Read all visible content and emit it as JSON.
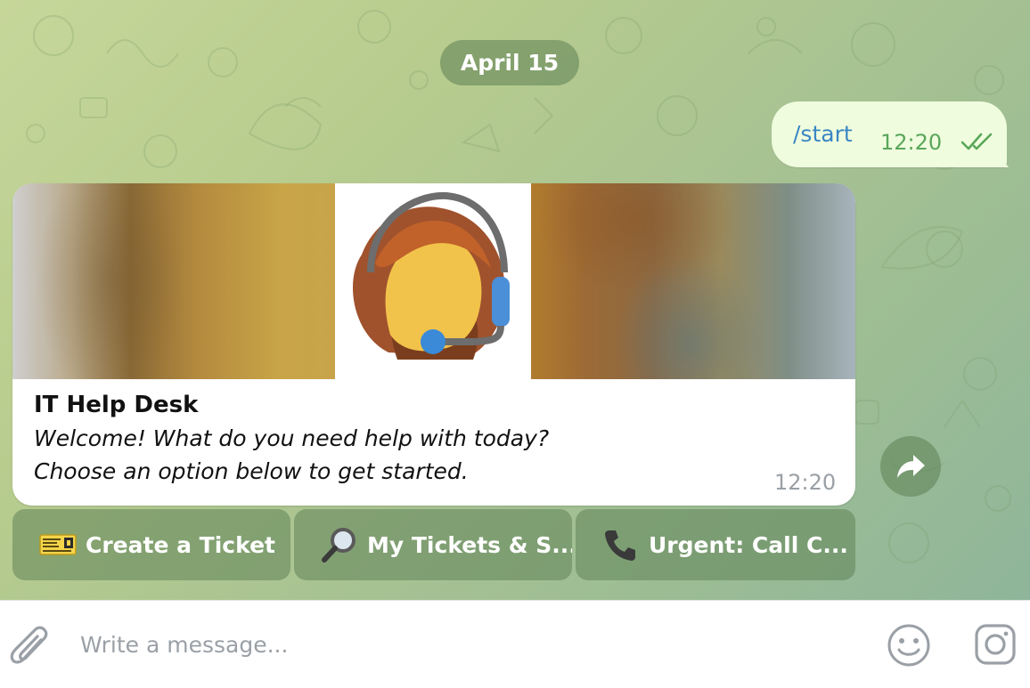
{
  "chat": {
    "date_label": "April 15",
    "outgoing": {
      "text": "/start",
      "time": "12:20",
      "status_icon": "double-check-icon"
    },
    "incoming": {
      "title": "IT Help Desk",
      "line1": "Welcome! What do you need help with today?",
      "line2": "Choose an option below to get started.",
      "time": "12:20",
      "media_icon": "support-agent-headset-icon"
    },
    "keyboard": [
      {
        "label": "Create a Ticket",
        "icon": "ticket-icon"
      },
      {
        "label": "My Tickets & S...",
        "icon": "magnifier-icon"
      },
      {
        "label": "Urgent: Call C...",
        "icon": "phone-icon"
      }
    ]
  },
  "composer": {
    "placeholder": "Write a message..."
  },
  "colors": {
    "link_blue": "#3a86c4",
    "outgoing_bubble": "#effdde",
    "outgoing_time": "#5aa65a",
    "overlay_green": "#5c8054"
  }
}
